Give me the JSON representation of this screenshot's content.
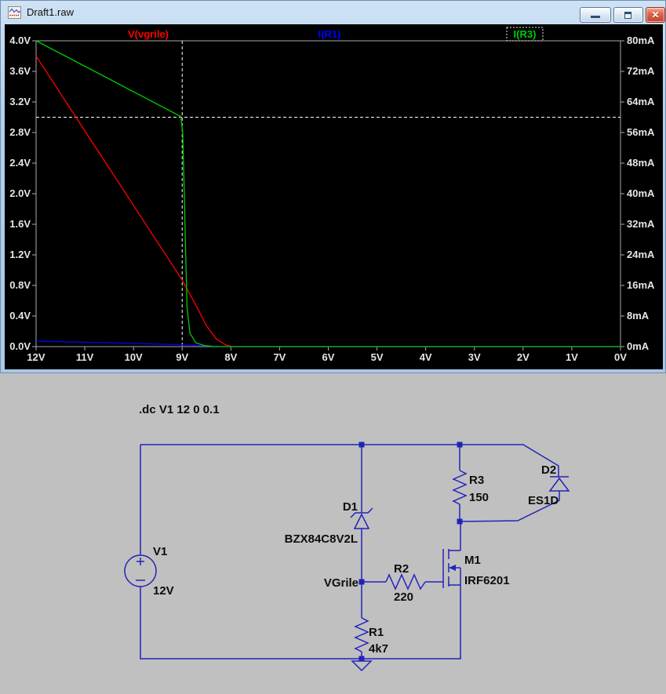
{
  "window": {
    "title": "Draft1.raw"
  },
  "chart_data": {
    "type": "line",
    "background": "#000000",
    "grid": false,
    "legend_position": "top",
    "x_axis": {
      "ticks": [
        "12V",
        "11V",
        "10V",
        "9V",
        "8V",
        "7V",
        "6V",
        "5V",
        "4V",
        "3V",
        "2V",
        "1V",
        "0V"
      ],
      "range": [
        12,
        0
      ]
    },
    "left_axis": {
      "ticks": [
        "4.0V",
        "3.6V",
        "3.2V",
        "2.8V",
        "2.4V",
        "2.0V",
        "1.6V",
        "1.2V",
        "0.8V",
        "0.4V",
        "0.0V"
      ],
      "range": [
        0,
        4
      ]
    },
    "right_axis": {
      "ticks": [
        "80mA",
        "72mA",
        "64mA",
        "56mA",
        "48mA",
        "40mA",
        "32mA",
        "24mA",
        "16mA",
        "8mA",
        "0mA"
      ],
      "range": [
        0,
        80
      ]
    },
    "cursor": {
      "x": 9,
      "right_value": 60
    },
    "series": [
      {
        "name": "V(vgrile)",
        "color": "#ff0000",
        "axis": "left",
        "points": [
          [
            12,
            3.8
          ],
          [
            9,
            0.87
          ],
          [
            8.7,
            0.52
          ],
          [
            8.5,
            0.27
          ],
          [
            8.3,
            0.1
          ],
          [
            8.1,
            0.02
          ],
          [
            7.95,
            0
          ],
          [
            0,
            0
          ]
        ]
      },
      {
        "name": "I(R1)",
        "color": "#0000ff",
        "axis": "right",
        "points": [
          [
            12,
            1.4
          ],
          [
            11,
            1.15
          ],
          [
            10,
            0.85
          ],
          [
            9,
            0.5
          ],
          [
            8.6,
            0.25
          ],
          [
            8.2,
            0.05
          ],
          [
            7.95,
            0
          ],
          [
            0,
            0
          ]
        ]
      },
      {
        "name": "I(R3)",
        "color": "#00cc00",
        "axis": "right",
        "selected": true,
        "points": [
          [
            12,
            80
          ],
          [
            9.03,
            60.2
          ],
          [
            8.99,
            56
          ],
          [
            8.96,
            42
          ],
          [
            8.93,
            25
          ],
          [
            8.9,
            10
          ],
          [
            8.84,
            3.5
          ],
          [
            8.72,
            1
          ],
          [
            8.55,
            0.3
          ],
          [
            8.35,
            0
          ],
          [
            0,
            0
          ]
        ]
      }
    ]
  },
  "schematic": {
    "directive": ".dc V1 12 0 0.1",
    "net_label": "VGrile",
    "wire_color": "#2222bb",
    "background": "#c0c0c0",
    "components": {
      "v1": {
        "name": "V1",
        "value": "12V"
      },
      "d1": {
        "name": "D1",
        "value": "BZX84C8V2L"
      },
      "d2": {
        "name": "D2",
        "value": "ES1D"
      },
      "r1": {
        "name": "R1",
        "value": "4k7"
      },
      "r2": {
        "name": "R2",
        "value": "220"
      },
      "r3": {
        "name": "R3",
        "value": "150"
      },
      "m1": {
        "name": "M1",
        "value": "IRF6201"
      }
    }
  }
}
